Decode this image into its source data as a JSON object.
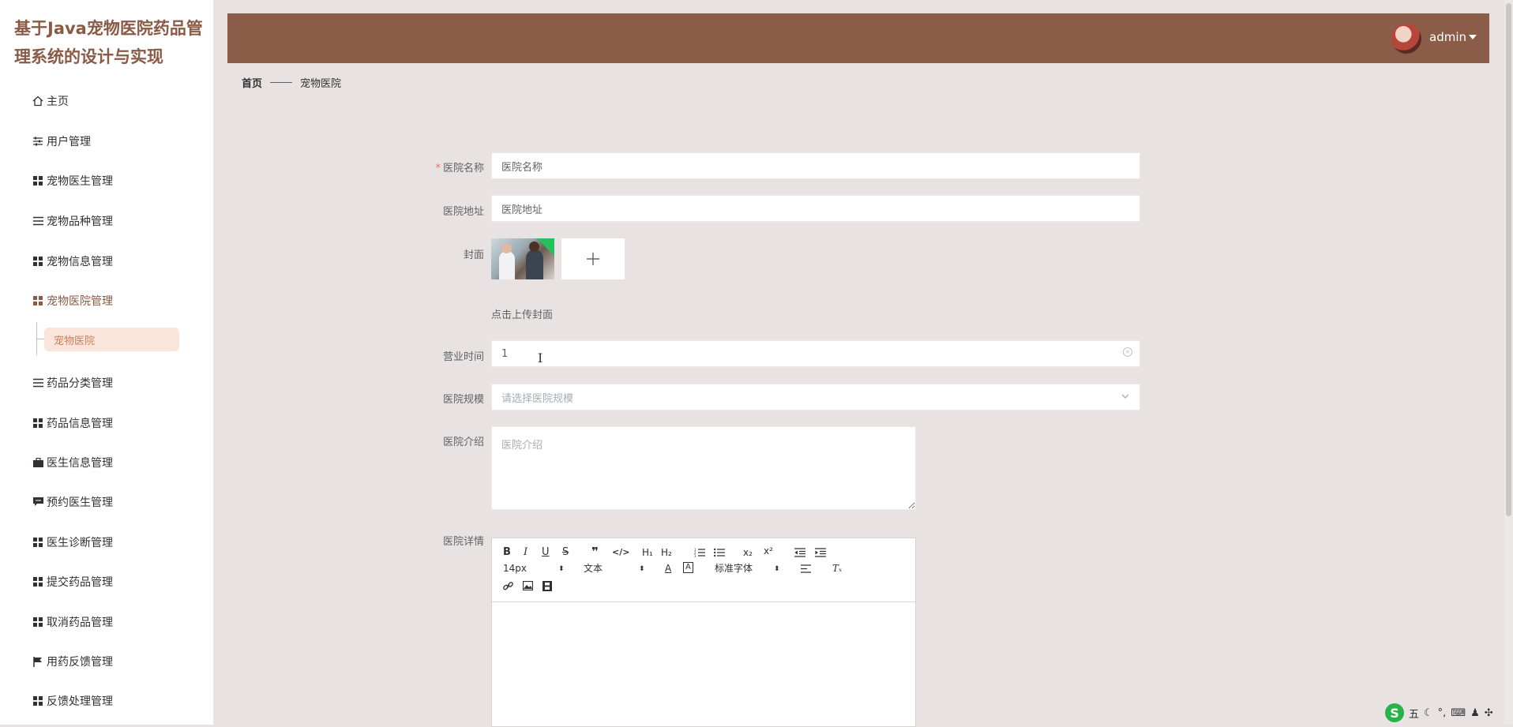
{
  "app": {
    "title": "基于Java宠物医院药品管理系统的设计与实现"
  },
  "header": {
    "user_name": "admin"
  },
  "sidebar": {
    "items": [
      {
        "label": "主页",
        "icon": "home-icon"
      },
      {
        "label": "用户管理",
        "icon": "sliders-icon"
      },
      {
        "label": "宠物医生管理",
        "icon": "grid-icon"
      },
      {
        "label": "宠物品种管理",
        "icon": "list-icon"
      },
      {
        "label": "宠物信息管理",
        "icon": "grid-icon"
      },
      {
        "label": "宠物医院管理",
        "icon": "grid-icon"
      },
      {
        "label": "药品分类管理",
        "icon": "list-icon"
      },
      {
        "label": "药品信息管理",
        "icon": "grid-icon"
      },
      {
        "label": "医生信息管理",
        "icon": "briefcase-icon"
      },
      {
        "label": "预约医生管理",
        "icon": "chat-icon"
      },
      {
        "label": "医生诊断管理",
        "icon": "grid-icon"
      },
      {
        "label": "提交药品管理",
        "icon": "grid-icon"
      },
      {
        "label": "取消药品管理",
        "icon": "grid-icon"
      },
      {
        "label": "用药反馈管理",
        "icon": "flag-icon"
      },
      {
        "label": "反馈处理管理",
        "icon": "grid-icon"
      }
    ],
    "active_submenu": "宠物医院"
  },
  "breadcrumb": {
    "home": "首页",
    "current": "宠物医院"
  },
  "form": {
    "name": {
      "label": "医院名称",
      "placeholder": "医院名称",
      "value": "医院名称",
      "required": true
    },
    "address": {
      "label": "医院地址",
      "placeholder": "医院地址",
      "value": "医院地址"
    },
    "cover": {
      "label": "封面",
      "hint": "点击上传封面"
    },
    "hours": {
      "label": "营业时间",
      "value": "1"
    },
    "scale": {
      "label": "医院规模",
      "placeholder": "请选择医院规模"
    },
    "intro": {
      "label": "医院介绍",
      "placeholder": "医院介绍"
    },
    "details": {
      "label": "医院详情"
    }
  },
  "editor": {
    "font_size": "14px",
    "header_type": "文本",
    "font_family": "标准字体"
  },
  "tray": {
    "ime_mode": "五"
  },
  "colors": {
    "header": "#8b5d48",
    "accent": "#8a5a45",
    "submenu_bg": "#fbe4d9"
  }
}
